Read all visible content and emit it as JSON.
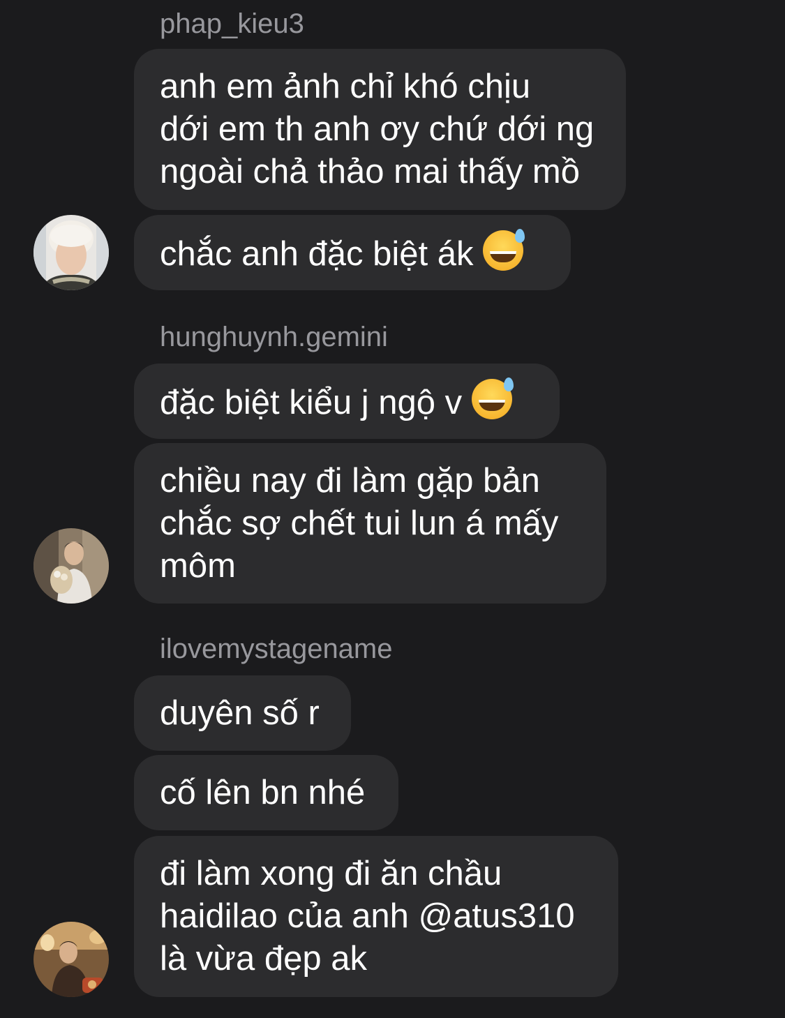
{
  "thread": {
    "groups": [
      {
        "sender": "phap_kieu3",
        "avatar_icon": "user-avatar-light-hair",
        "messages": [
          {
            "lines": [
              "anh em ảnh chỉ khó chịu",
              "dới em th anh ơy chứ dới ng",
              "ngoài chả thảo mai thấy mồ"
            ],
            "emoji": ""
          },
          {
            "lines": [
              "chắc anh đặc biệt ák"
            ],
            "emoji": "grinning-face-with-sweat"
          }
        ]
      },
      {
        "sender": "hunghuynh.gemini",
        "avatar_icon": "user-avatar-holding-flowers",
        "messages": [
          {
            "lines": [
              "đặc biệt kiểu j ngộ v"
            ],
            "emoji": "grinning-face-with-sweat"
          },
          {
            "lines": [
              "chiều nay đi làm gặp bản",
              "chắc sợ chết tui lun á mấy",
              "môm"
            ],
            "emoji": ""
          }
        ]
      },
      {
        "sender": "ilovemystagename",
        "avatar_icon": "user-avatar-seated-restaurant",
        "messages": [
          {
            "lines": [
              "duyên số r"
            ],
            "emoji": ""
          },
          {
            "lines": [
              "cố lên bn nhé"
            ],
            "emoji": ""
          },
          {
            "lines": [
              "đi làm xong đi ăn chầu",
              "haidilao của anh @atus310",
              "là vừa đẹp ak"
            ],
            "emoji": ""
          }
        ]
      }
    ]
  },
  "colors": {
    "background": "#1b1b1d",
    "bubble": "#2c2c2e",
    "sender_text": "#98989d",
    "message_text": "#ffffff"
  }
}
